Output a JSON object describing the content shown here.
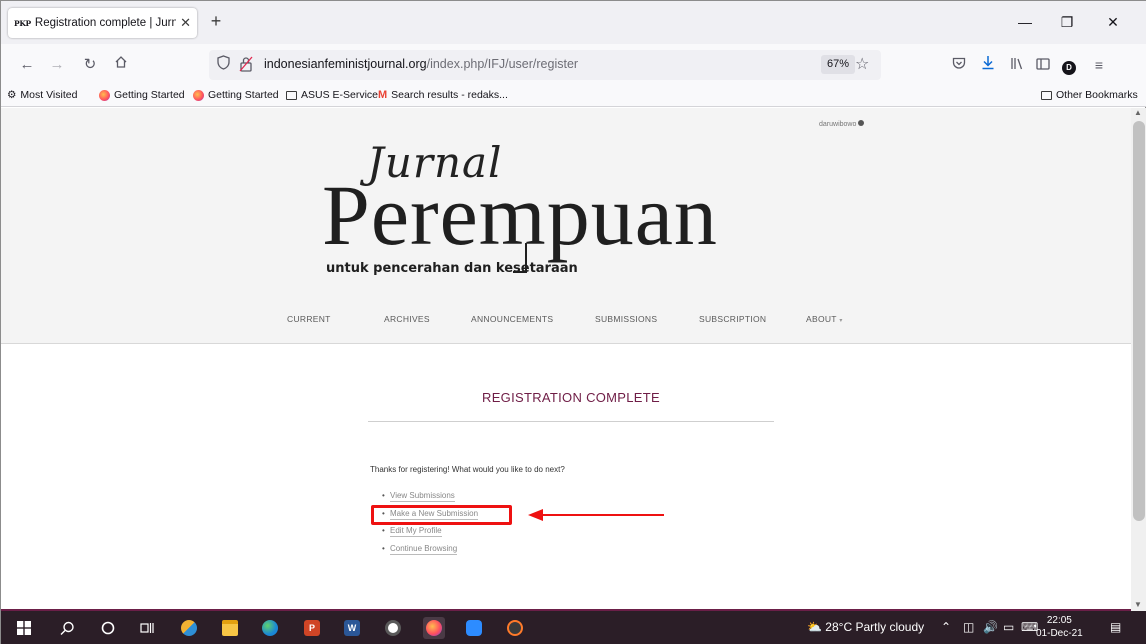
{
  "browser": {
    "tab": {
      "favicon_text": "PKP",
      "title": "Registration complete | Jurnal P",
      "close_icon": "close-icon"
    },
    "window_controls": {
      "minimize": "—",
      "restore": "❐",
      "close": "✕"
    },
    "new_tab": "+",
    "url": {
      "domain": "indonesianfeministjournal.org",
      "path": "/index.php/IFJ/user/register"
    },
    "zoom": "67%",
    "bookmarks": [
      {
        "label": "Most Visited",
        "icon": "gear-icon"
      },
      {
        "label": "Getting Started",
        "icon": "firefox-icon"
      },
      {
        "label": "Getting Started",
        "icon": "firefox-icon"
      },
      {
        "label": "ASUS E-Service",
        "icon": "folder-icon"
      },
      {
        "label": "Search results - redaks...",
        "icon": "gmail-icon"
      }
    ],
    "other_bookmarks": "Other Bookmarks",
    "avatar_letter": "D"
  },
  "site": {
    "user": "daruwibowo",
    "logo": {
      "script": "Jurnal",
      "main": "Perempuan",
      "tagline": "untuk pencerahan dan kesetaraan"
    },
    "menu": [
      "CURRENT",
      "ARCHIVES",
      "ANNOUNCEMENTS",
      "SUBMISSIONS",
      "SUBSCRIPTION",
      "ABOUT"
    ]
  },
  "content": {
    "title": "REGISTRATION COMPLETE",
    "thanks": "Thanks for registering! What would you like to do next?",
    "links": [
      "View Submissions",
      "Make a New Submission",
      "Edit My Profile",
      "Continue Browsing"
    ]
  },
  "annotation": {
    "color": "#ee1111",
    "highlighted_link": "Make a New Submission"
  },
  "colors": {
    "accent": "#6f1d46",
    "taskbar": "#2b1e27"
  },
  "taskbar": {
    "weather": "28°C  Partly cloudy",
    "time": "22:05",
    "date": "01-Dec-21"
  }
}
